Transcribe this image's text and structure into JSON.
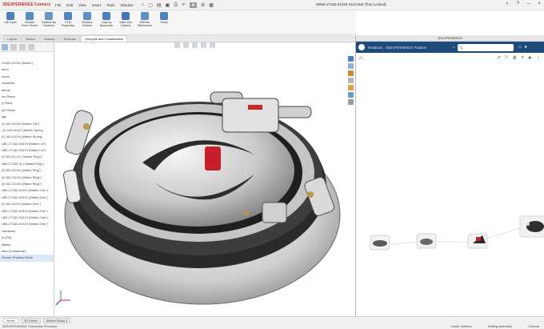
{
  "app": {
    "brand": "3DEXPERIENCE Connected",
    "document_title": "WBW-27182-01025 SLDASM *[Not Locked]"
  },
  "menu": [
    "File",
    "Edit",
    "View",
    "Insert",
    "Tools",
    "Window"
  ],
  "ribbon": {
    "buttons": [
      {
        "label": "Life Cycle",
        "color": "#4a7fc0"
      },
      {
        "label": "Reload From Server",
        "color": "#5a8ac4"
      },
      {
        "label": "Restore By Revision",
        "color": "#6b95c9"
      },
      {
        "label": "PLM Properties",
        "color": "#4f86c6"
      },
      {
        "label": "Replace Content",
        "color": "#5c8fcb"
      },
      {
        "label": "Load by Bookmark",
        "color": "#4c7fbf"
      },
      {
        "label": "Save with Options",
        "color": "#3e77bd"
      },
      {
        "label": "Refresh MySession",
        "color": "#5a8fc8"
      },
      {
        "label": "Share",
        "color": "#4a83c2"
      }
    ]
  },
  "tabs": [
    "Layout",
    "Sketch",
    "Markup",
    "Evaluate",
    "Lifecycle and Collaboration"
  ],
  "active_tab": "Lifecycle and Collaboration",
  "tree": {
    "items": [
      "01182-01025 (Watch )",
      "story",
      "nsors",
      "notations",
      "ations",
      "ont Plane",
      "p Plane",
      "ght Plane",
      "igin",
      "(f) 182-01015 (Watch Lid\")",
      "-(f) 182-01013 (Watch Spring",
      "(f) 182-01014 (Watch Spring",
      "UB1-27182-01019 (Watch Lid\")",
      "UB1-27182-01019 (Watch Lid\")",
      "(f) 182-01-01 (\"Watch Ring\")",
      "UB1-27182-01 (\"Watch Ring\")",
      "(f) 182-01041 (Watch Ring\")",
      "(f) 182-01019 (Watch Ring\")",
      "(f) 182-01020 (Watch Ring\")",
      "UB1-27182-01019 (Watch Zinc\")",
      "UB1-27182-01019 (Watch Zinc\")",
      "(f) 182-01019 (Watch Zinc\")",
      "UB1-27182-01019 (Watch Zinc\")",
      "UB1-27182-01019 (Watch Zinc\")",
      "UB1-27182-01019 (Watch Zinc\")",
      "Hardware",
      "ts (Fill)",
      "Mates",
      "ation (Collaborat)",
      "Sensor Position Block"
    ],
    "highlighted_index": 29
  },
  "xp": {
    "header": "3DEXPERIENCE",
    "bar_title": "Relations · 3DEXPERIENCE Position",
    "search_placeholder": "Search",
    "brand_color": "#1f4a7c"
  },
  "model_tabs": [
    "Model",
    "3D Views",
    "Motion Study 1"
  ],
  "status": {
    "left": "3DEXPERIENCE Connected Premium",
    "middle": "Under Defined",
    "editing": "Editing Assembly",
    "right": "Custom"
  }
}
